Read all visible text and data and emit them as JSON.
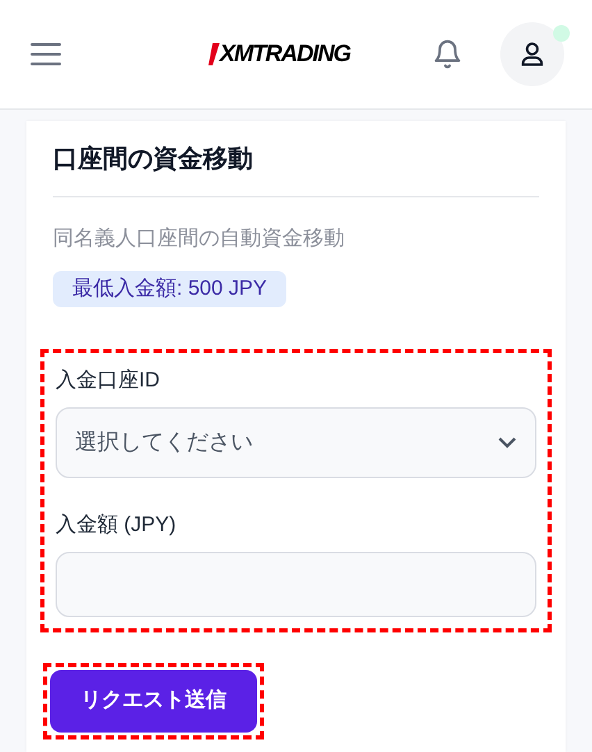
{
  "header": {
    "logo": "XMTRADING"
  },
  "card": {
    "title": "口座間の資金移動",
    "subtitle": "同名義人口座間の自動資金移動",
    "badge": "最低入金額: 500 JPY"
  },
  "form": {
    "highlighted": true,
    "fields": [
      {
        "kind": "select",
        "label": "入金口座ID",
        "placeholder": "選択してください"
      },
      {
        "kind": "input",
        "label": "入金額 (JPY)"
      }
    ]
  },
  "submit": {
    "label": "リクエスト送信",
    "highlighted": true
  }
}
